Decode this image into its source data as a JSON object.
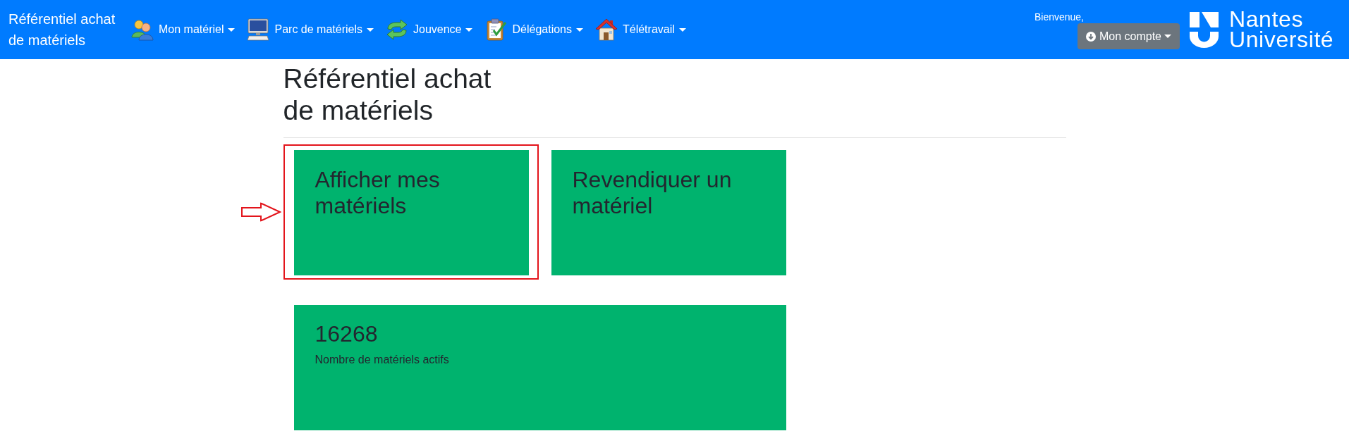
{
  "navbar": {
    "brand": "Référentiel achat de matériels",
    "menus": [
      {
        "label": "Mon matériel"
      },
      {
        "label": "Parc de matériels"
      },
      {
        "label": "Jouvence"
      },
      {
        "label": "Délégations"
      },
      {
        "label": "Télétravail"
      }
    ],
    "welcome": "Bienvenue,",
    "account_button": "Mon compte",
    "logo": "Nantes Université"
  },
  "page": {
    "title": "Référentiel achat de matériels"
  },
  "cards": [
    {
      "kind": "link",
      "title": "Afficher mes matériels",
      "highlighted": true
    },
    {
      "kind": "link",
      "title": "Revendiquer un matériel",
      "highlighted": false
    },
    {
      "kind": "stat",
      "value": "16268",
      "caption": "Nombre de matériels actifs",
      "highlighted": false
    }
  ]
}
